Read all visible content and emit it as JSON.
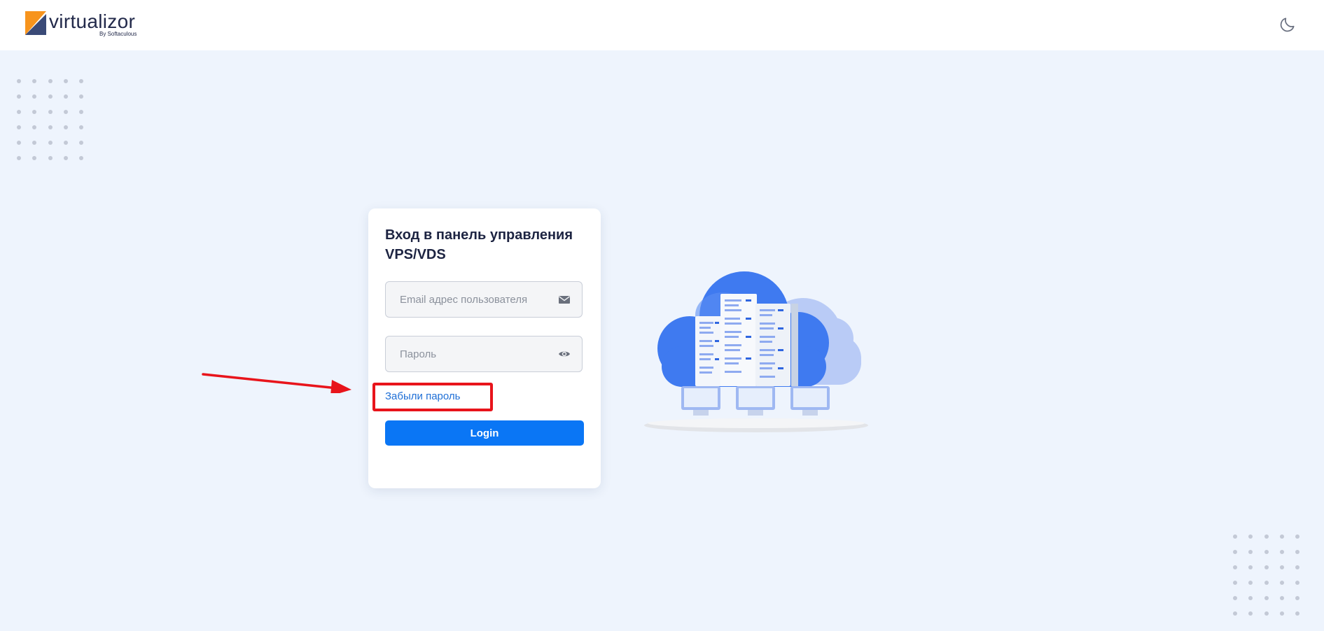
{
  "header": {
    "logo_text": "virtualizor",
    "logo_subtitle": "By Softaculous",
    "theme_toggle_icon": "moon-icon"
  },
  "login": {
    "title": "Вход в панель управления VPS/VDS",
    "email_placeholder": "Email адрес пользователя",
    "email_icon": "envelope-icon",
    "password_placeholder": "Пароль",
    "password_icon": "eye-icon",
    "forgot_password": "Забыли пароль",
    "submit_label": "Login"
  },
  "colors": {
    "background": "#eef4fd",
    "primary_button": "#0a76f5",
    "link": "#1f6fd6",
    "annotation_red": "#e8141b",
    "logo_orange": "#f7941d",
    "logo_navy": "#3a4a77"
  },
  "illustration": {
    "icon": "cloud-servers-illustration"
  }
}
